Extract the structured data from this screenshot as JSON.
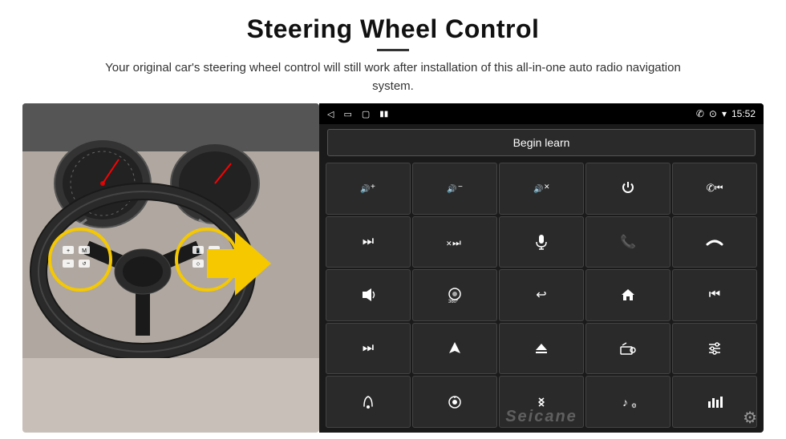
{
  "header": {
    "title": "Steering Wheel Control",
    "subtitle": "Your original car's steering wheel control will still work after installation of this all-in-one auto radio navigation system.",
    "divider": true
  },
  "status_bar": {
    "nav_back": "◁",
    "nav_home_rect": "▭",
    "nav_square": "▢",
    "battery_icon": "▮▮",
    "phone_icon": "✆",
    "location_icon": "⊙",
    "wifi_icon": "▾",
    "time": "15:52"
  },
  "begin_learn_button": "Begin learn",
  "controls": [
    {
      "icon": "🔊+",
      "label": "vol-up"
    },
    {
      "icon": "🔊−",
      "label": "vol-down"
    },
    {
      "icon": "🔇",
      "label": "mute"
    },
    {
      "icon": "⏻",
      "label": "power"
    },
    {
      "icon": "⏮",
      "label": "prev-track-phone"
    },
    {
      "icon": "⏭",
      "label": "next"
    },
    {
      "icon": "⏸⏭",
      "label": "pause-next"
    },
    {
      "icon": "🎤",
      "label": "mic"
    },
    {
      "icon": "📞",
      "label": "call"
    },
    {
      "icon": "📵",
      "label": "end-call"
    },
    {
      "icon": "📢",
      "label": "horn"
    },
    {
      "icon": "360°",
      "label": "camera-360"
    },
    {
      "icon": "↩",
      "label": "back"
    },
    {
      "icon": "🏠",
      "label": "home"
    },
    {
      "icon": "⏮⏮",
      "label": "prev"
    },
    {
      "icon": "⏭⏭",
      "label": "fast-forward"
    },
    {
      "icon": "▶",
      "label": "navigate"
    },
    {
      "icon": "⏏",
      "label": "eject"
    },
    {
      "icon": "📻",
      "label": "radio"
    },
    {
      "icon": "≡|",
      "label": "equalizer"
    },
    {
      "icon": "🎙",
      "label": "voice"
    },
    {
      "icon": "⊙",
      "label": "settings-knob"
    },
    {
      "icon": "✦",
      "label": "bluetooth"
    },
    {
      "icon": "🎵",
      "label": "music-settings"
    },
    {
      "icon": "|||",
      "label": "audio-levels"
    }
  ],
  "watermark": "Seicane",
  "settings_icon": "⚙"
}
